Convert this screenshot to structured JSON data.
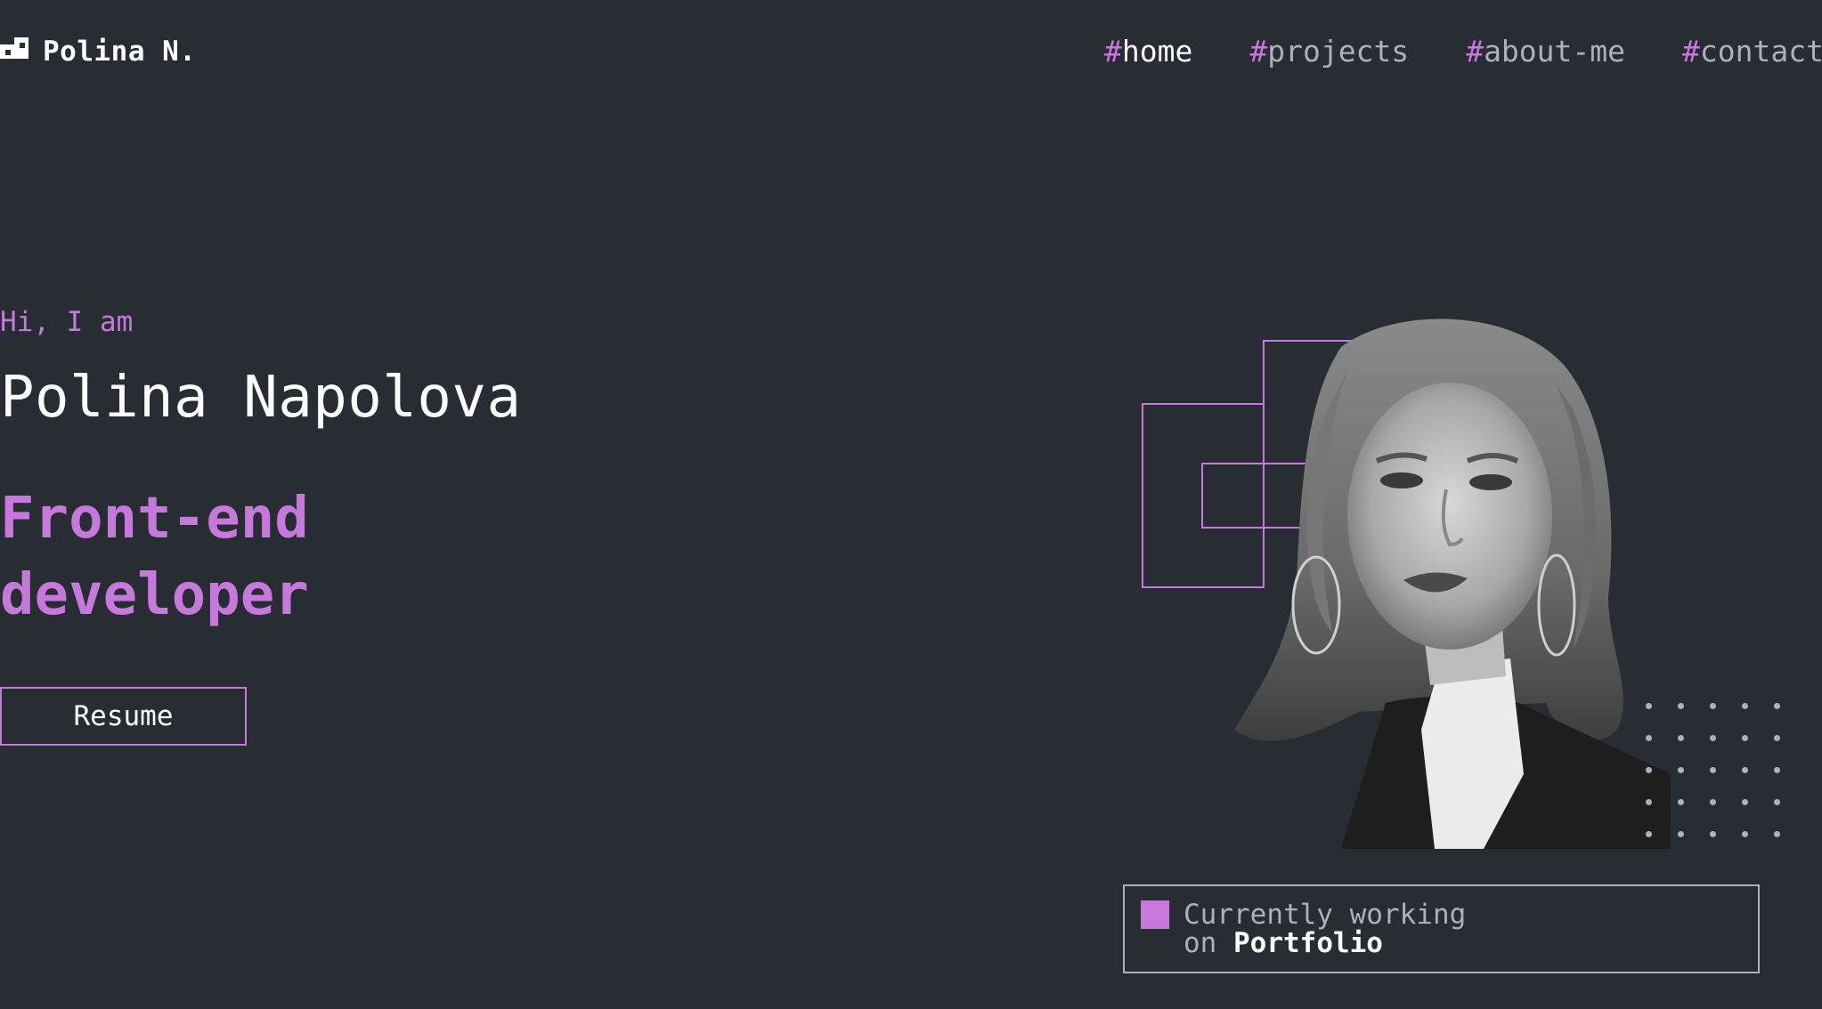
{
  "header": {
    "logo_text": "Polina N.",
    "nav": [
      {
        "hash": "#",
        "label": "home"
      },
      {
        "hash": "#",
        "label": "projects"
      },
      {
        "hash": "#",
        "label": "about-me"
      },
      {
        "hash": "#",
        "label": "contacts"
      }
    ]
  },
  "hero": {
    "greeting": "Hi, I am",
    "name": "Polina Napolova",
    "role_line1": "Front-end",
    "role_line2": "developer",
    "resume_label": "Resume"
  },
  "status": {
    "line1": "Currently working",
    "prefix": "on",
    "project": "Portfolio"
  },
  "colors": {
    "background": "#282c33",
    "accent": "#c778dd",
    "text_muted": "#abb2bf",
    "text_primary": "#ffffff"
  },
  "icons": {
    "logo": "logo-icon",
    "status": "status-square-icon"
  }
}
